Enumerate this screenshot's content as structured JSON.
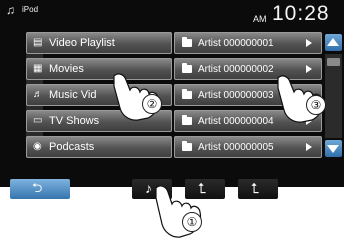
{
  "status": {
    "source": "iPod",
    "ampm": "AM",
    "time": "10:28"
  },
  "categories": [
    {
      "label": "Video Playlist",
      "icon": "video-playlist-icon"
    },
    {
      "label": "Movies",
      "icon": "film-icon"
    },
    {
      "label": "Music Vid",
      "icon": "music-video-icon"
    },
    {
      "label": "TV Shows",
      "icon": "tv-icon"
    },
    {
      "label": "Podcasts",
      "icon": "podcast-icon"
    }
  ],
  "artists": [
    {
      "label": "Artist 000000001"
    },
    {
      "label": "Artist 000000002"
    },
    {
      "label": "Artist 000000003"
    },
    {
      "label": "Artist 000000004"
    },
    {
      "label": "Artist 000000005"
    }
  ],
  "toolbar": {
    "music_glyph": "♪",
    "up_glyph": "⮤",
    "top_glyph": "⮤",
    "back_glyph": "⮌"
  },
  "callouts": [
    "①",
    "②",
    "③"
  ],
  "colors": {
    "screen_bg": "#0b0b0c",
    "accent_blue": "#3575ad",
    "row_gray": "#525252"
  }
}
